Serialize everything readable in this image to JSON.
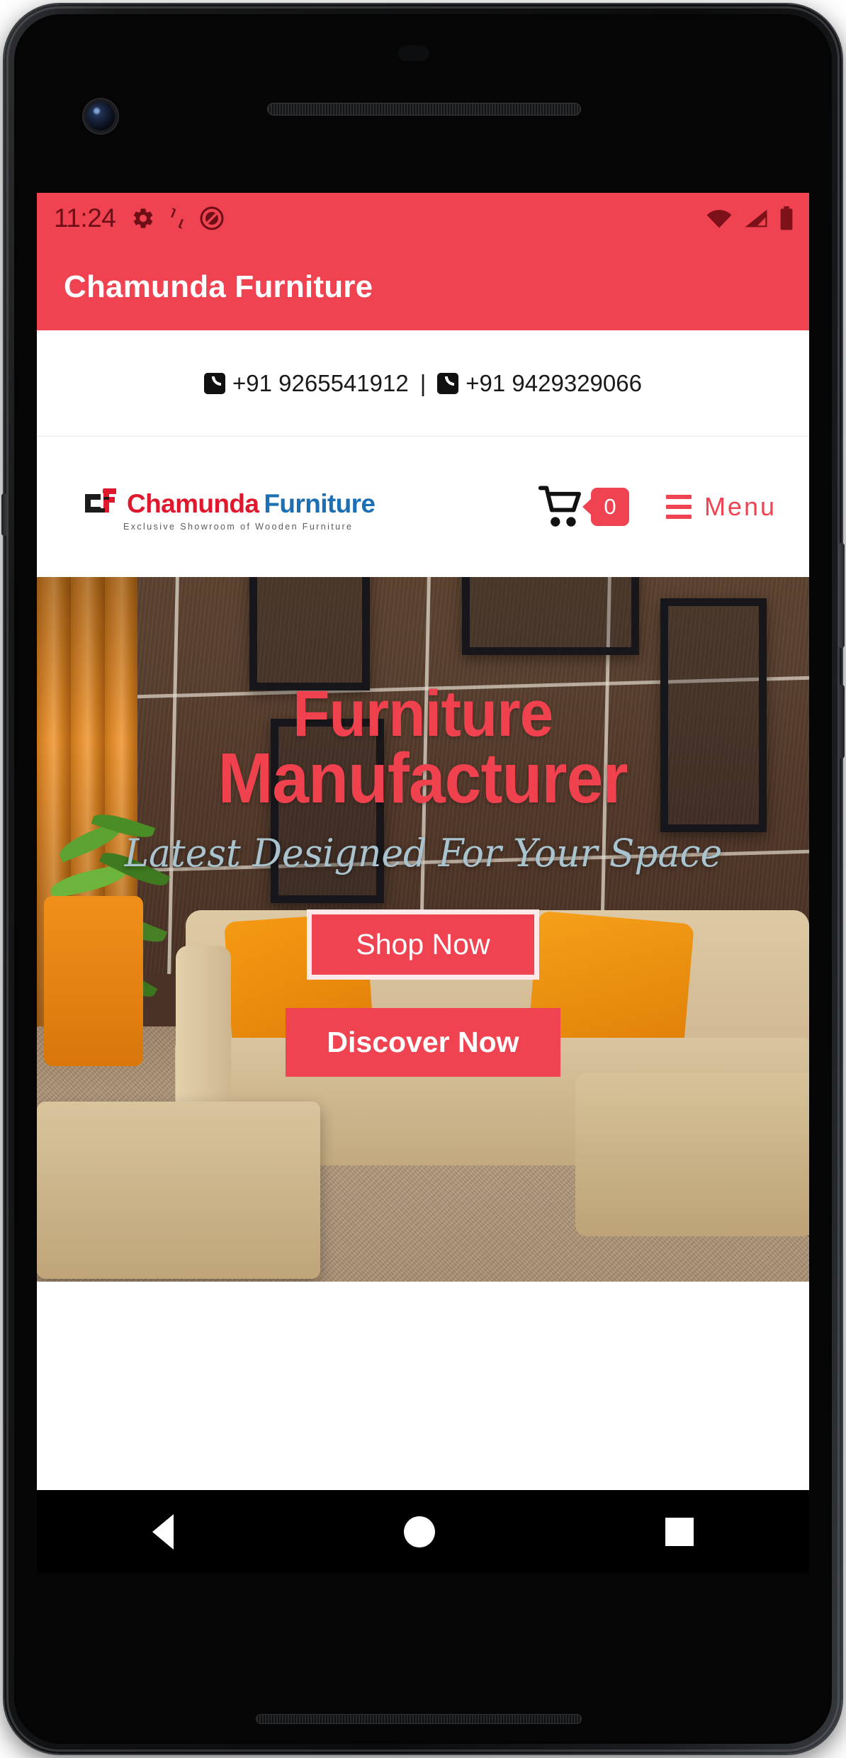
{
  "device": {
    "camera_icon": "camera-lens",
    "speaker_icon": "earpiece-speaker"
  },
  "statusbar": {
    "time": "11:24",
    "left_icons": [
      "gear-icon",
      "data-transfer-icon",
      "do-not-disturb-icon"
    ],
    "right_icons": [
      "wifi-icon",
      "cell-signal-icon",
      "battery-icon"
    ],
    "background": "#ef4351"
  },
  "appbar": {
    "title": "Chamunda Furniture",
    "background": "#ef4351",
    "text_color": "#ffffff"
  },
  "contactbar": {
    "phone_1": "+91 9265541912",
    "separator": "|",
    "phone_2": "+91 9429329066",
    "icon": "phone-icon"
  },
  "sitenav": {
    "logo": {
      "mark": "cf-monogram",
      "word_1": "Chamunda",
      "word_2": "Furniture",
      "word_1_color": "#e0182d",
      "word_2_color": "#1a6fb5",
      "tagline": "Exclusive Showroom of Wooden Furniture"
    },
    "cart": {
      "icon": "shopping-cart-icon",
      "count": "0",
      "badge_color": "#ef4351"
    },
    "menu": {
      "icon": "hamburger-menu-icon",
      "label": "Menu",
      "color": "#ef4351"
    }
  },
  "hero": {
    "heading_line_1": "Furniture",
    "heading_line_2": "Manufacturer",
    "heading_color": "#f0414f",
    "subheading": "Latest Designed For Your Space",
    "subheading_color": "#a9c3cf",
    "primary_button": "Shop Now",
    "secondary_button": "Discover Now",
    "button_color": "#ef4351",
    "background_description": "living-room-sofa-photo"
  },
  "androidnav": {
    "back": "back-triangle-icon",
    "home": "home-circle-icon",
    "recents": "recents-square-icon"
  }
}
